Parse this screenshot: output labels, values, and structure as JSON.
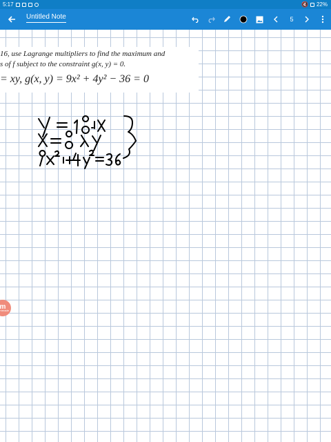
{
  "status_bar": {
    "time": "5:17",
    "battery": "22%"
  },
  "toolbar": {
    "title": "Untitled Note",
    "page_number": "5",
    "pen_color": "#000000"
  },
  "problem": {
    "line1": "16, use Lagrange multipliers to find the maximum and",
    "line2": "s of f subject to the constraint g(x, y) = 0.",
    "line3": "= xy, g(x, y) = 9x² + 4y² − 36 = 0"
  },
  "handwriting": {
    "eq1": "y = 18λx",
    "eq2": "x = 8λy",
    "eq3": "9x² + 4y² = 36"
  },
  "fab": {
    "letter": "m",
    "sub": "numerade"
  }
}
